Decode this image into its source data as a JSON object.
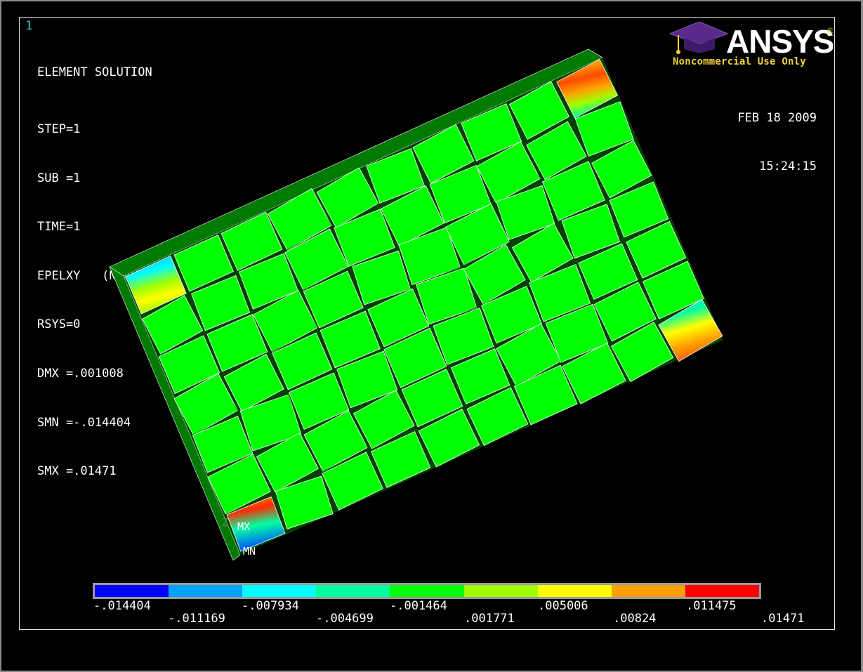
{
  "window_number": "1",
  "header": {
    "title": "ELEMENT SOLUTION",
    "lines": [
      "STEP=1",
      "SUB =1",
      "TIME=1",
      "EPELXY   (NOAVG)",
      "RSYS=0",
      "DMX =.001008",
      "SMN =-.014404",
      "SMX =.01471"
    ]
  },
  "date": "FEB 18 2009",
  "time": "15:24:15",
  "logo": {
    "text": "ANSYS",
    "registered": "®",
    "subtitle": "Noncommercial Use Only",
    "color": "#f0d23c",
    "icon": "graduation-cap-icon"
  },
  "model_labels": {
    "mx": "MX",
    "mn": "MN",
    "axis": "Z"
  },
  "legend": {
    "colors": [
      "#0000ff",
      "#00a0ff",
      "#00ffff",
      "#00ffa0",
      "#00ff00",
      "#a0ff00",
      "#ffff00",
      "#ffa000",
      "#ff0000"
    ],
    "ticks_top": [
      "-.014404",
      "-.007934",
      "-.001464",
      ".005006",
      ".011475"
    ],
    "ticks_bottom": [
      "-.011169",
      "-.004699",
      ".001771",
      ".00824",
      ".01471"
    ]
  },
  "colors": {
    "element_green": "#00ff00",
    "side_face_green": "#007a00",
    "edge_white": "#ffffff",
    "viewport_border": "#e0e0e0",
    "window_number": "#36c8c8"
  }
}
